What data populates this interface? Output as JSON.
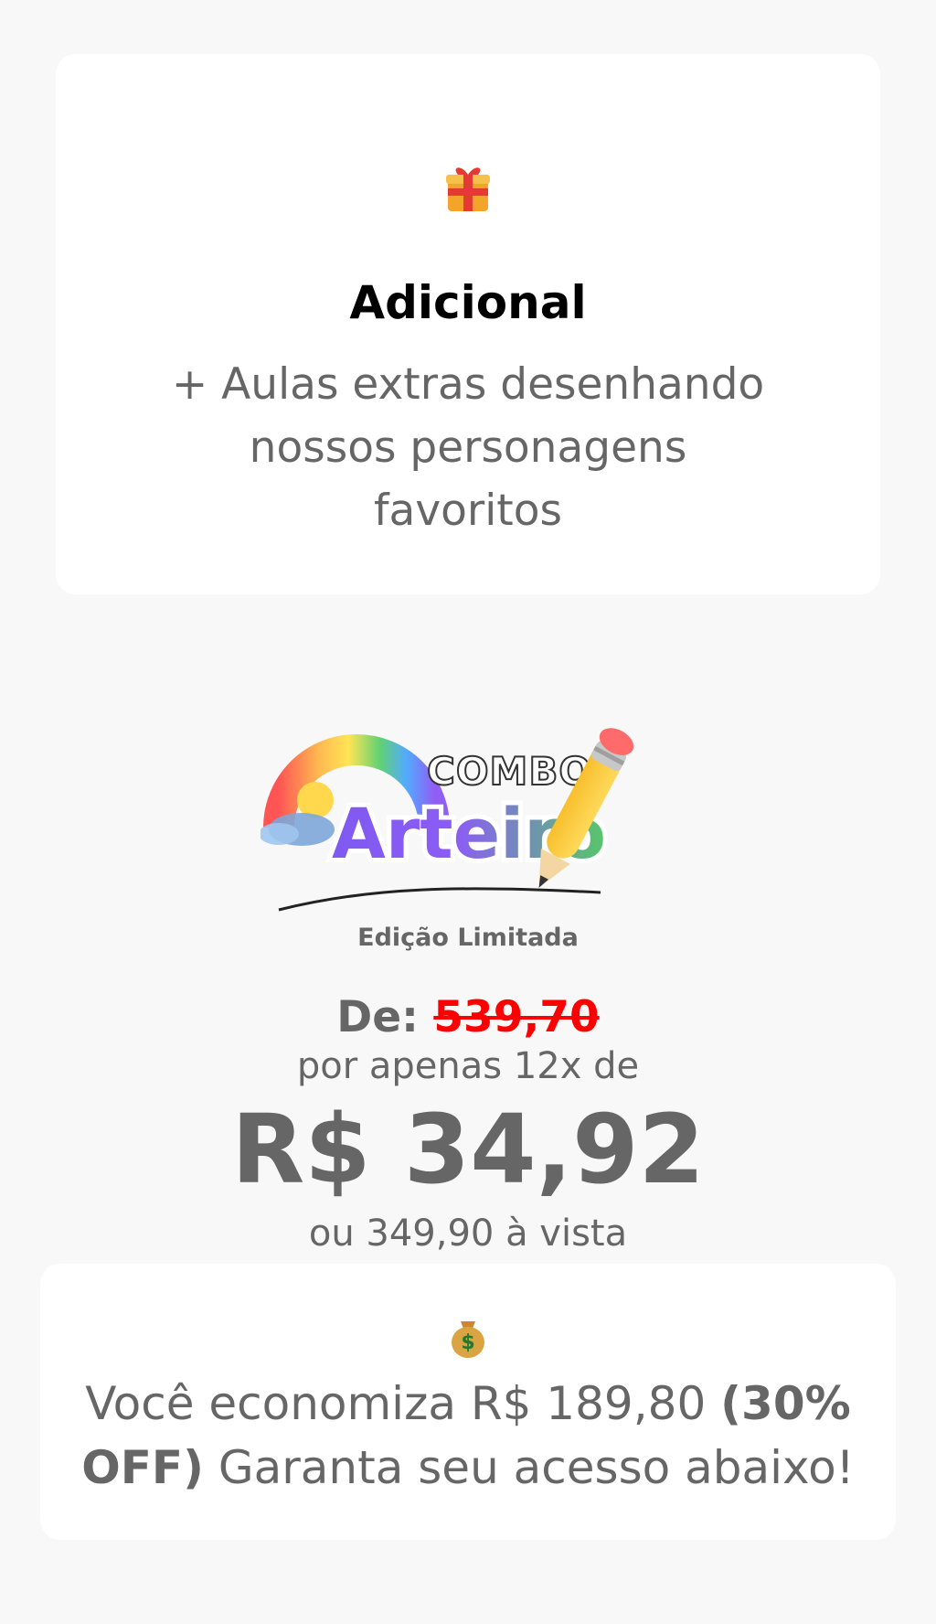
{
  "addon_card": {
    "icon": "gift-icon",
    "title": "Adicional",
    "description": "+ Aulas extras desenhando nossos personagens favoritos"
  },
  "product": {
    "logo_small_text": "COMBO",
    "logo_main_text": "Arteiro",
    "subtitle": "Edição Limitada"
  },
  "pricing": {
    "old_label": "De:",
    "old_price": "539,70",
    "installment_text": "por apenas 12x de",
    "installment_price": "R$ 34,92",
    "cash_text": "ou 349,90 à vista"
  },
  "savings_card": {
    "icon": "money-bag-icon",
    "text_start": "Você economiza R$ 189,80",
    "text_strong": "(30% OFF)",
    "text_end": "Garanta seu acesso abaixo!"
  },
  "colors": {
    "background": "#f8f8f8",
    "card": "#ffffff",
    "text": "#666666",
    "strike": "#ff0000",
    "heading": "#000000"
  }
}
